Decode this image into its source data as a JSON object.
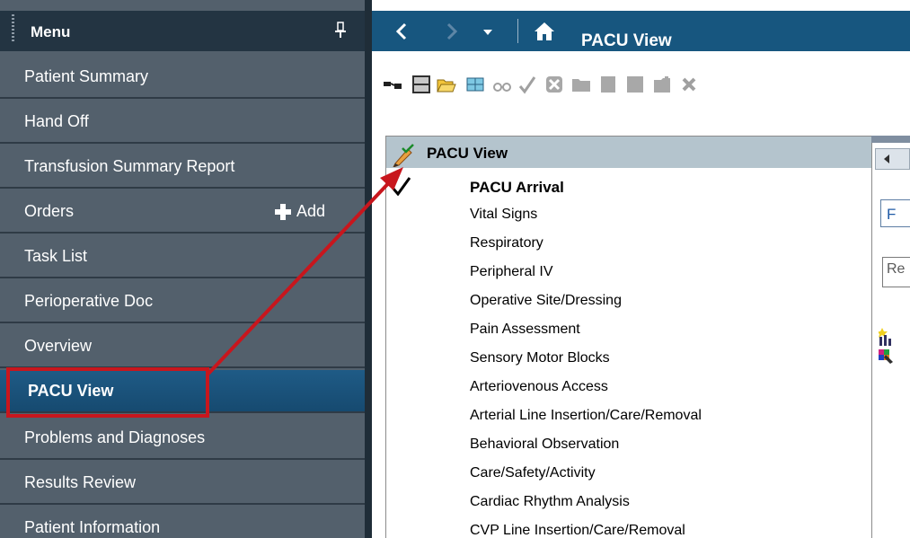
{
  "menu": {
    "title": "Menu",
    "items": [
      {
        "label": "Patient Summary"
      },
      {
        "label": "Hand Off"
      },
      {
        "label": "Transfusion Summary Report"
      },
      {
        "label": "Orders",
        "action": "Add"
      },
      {
        "label": "Task List"
      },
      {
        "label": "Perioperative Doc"
      },
      {
        "label": "Overview"
      },
      {
        "label": "PACU View",
        "selected": true
      },
      {
        "label": "Problems and Diagnoses"
      },
      {
        "label": "Results Review"
      },
      {
        "label": "Patient Information"
      }
    ]
  },
  "header": {
    "title": "PACU View",
    "icons": [
      "back-icon",
      "forward-icon",
      "history-dropdown-icon",
      "home-icon"
    ]
  },
  "toolbar": {
    "icons": [
      "link-icon",
      "layout-icon",
      "open-folder-icon",
      "grid-icon",
      "glasses-icon",
      "checkmark-icon",
      "cancel-icon",
      "folder-icon",
      "document-icon",
      "block-icon",
      "clipboard-icon",
      "close-icon"
    ]
  },
  "document": {
    "title": "PACU View",
    "first_section": "PACU Arrival",
    "sections": [
      "Vital Signs",
      "Respiratory",
      "Peripheral IV",
      "Operative Site/Dressing",
      "Pain Assessment",
      "Sensory Motor Blocks",
      "Arteriovenous Access",
      "Arterial Line Insertion/Care/Removal",
      "Behavioral Observation",
      "Care/Safety/Activity",
      "Cardiac Rhythm Analysis",
      "CVP Line Insertion/Care/Removal"
    ]
  },
  "right_frame": {
    "field_text": "F",
    "field2_text": "Re"
  },
  "colors": {
    "sidebar_bg": "#53606c",
    "sidebar_header": "#233442",
    "selected_item": "#1f5b86",
    "titlebar": "#17567f",
    "highlight_red": "#c8161d",
    "doc_header": "#b4c4cd"
  }
}
